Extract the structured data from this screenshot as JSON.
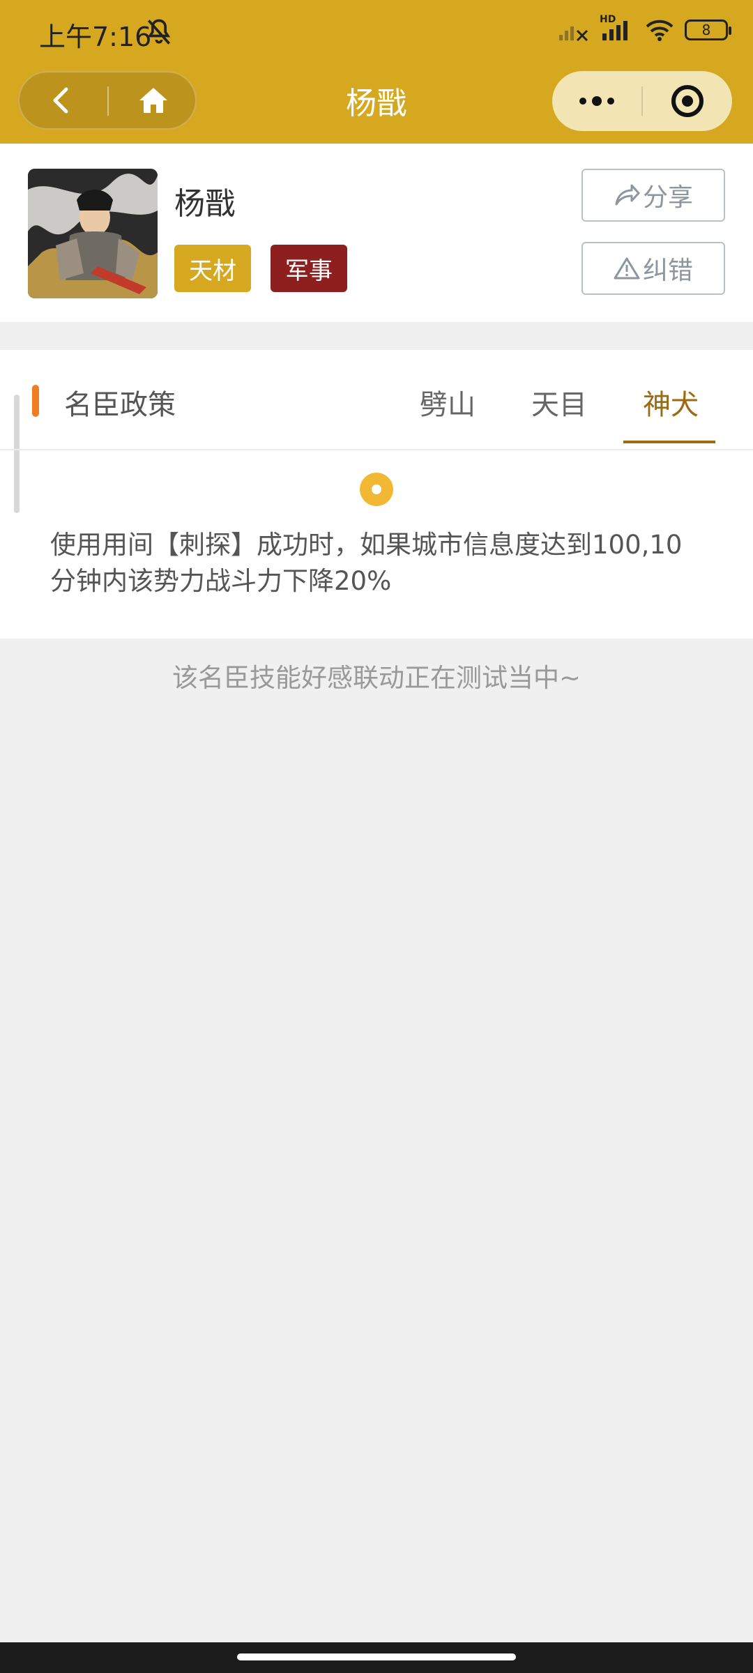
{
  "status_bar": {
    "time": "上午7:16",
    "network_badge": "HD",
    "battery": "8"
  },
  "nav": {
    "title": "杨戬"
  },
  "profile": {
    "name": "杨戬",
    "tags": [
      "天材",
      "军事"
    ],
    "share_label": "分享",
    "report_label": "纠错"
  },
  "skills": {
    "section_title": "名臣政策",
    "tabs": [
      "劈山",
      "天目",
      "神犬"
    ],
    "active_tab": "神犬",
    "description": "使用用间【刺探】成功时，如果城市信息度达到100,10分钟内该势力战斗力下降20%"
  },
  "notice": "该名臣技能好感联动正在测试当中~",
  "colors": {
    "header": "#d6a820",
    "tag_talent": "#d6a820",
    "tag_military": "#8d1f1f",
    "accent_bar": "#f07d22",
    "active_tab": "#9a6b12"
  }
}
